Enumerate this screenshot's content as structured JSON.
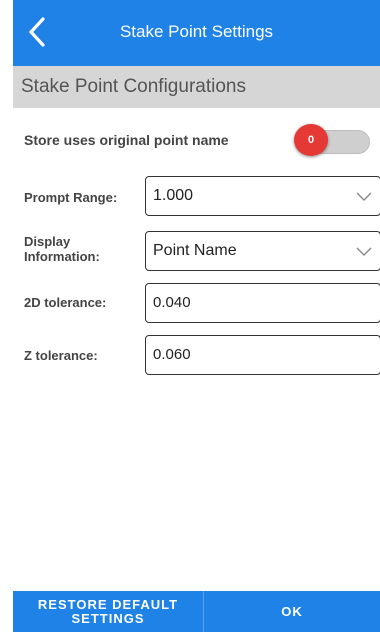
{
  "header": {
    "title": "Stake Point Settings",
    "back_icon": "back-chevron-icon"
  },
  "section": {
    "title": "Stake Point Configurations"
  },
  "store_original_name": {
    "label": "Store uses original point name",
    "toggle_state": "0",
    "on": false
  },
  "prompt_range": {
    "label": "Prompt Range:",
    "value": "1.000"
  },
  "display_information": {
    "label": "Display Information:",
    "value": "Point Name"
  },
  "tolerance_2d": {
    "label": "2D tolerance:",
    "value": "0.040"
  },
  "tolerance_z": {
    "label": "Z tolerance:",
    "value": "0.060"
  },
  "footer": {
    "restore_label": "RESTORE DEFAULT SETTINGS",
    "ok_label": "OK"
  },
  "colors": {
    "primary": "#1e82e6",
    "section_bg": "#d6d6d6",
    "toggle_thumb": "#e53935"
  }
}
